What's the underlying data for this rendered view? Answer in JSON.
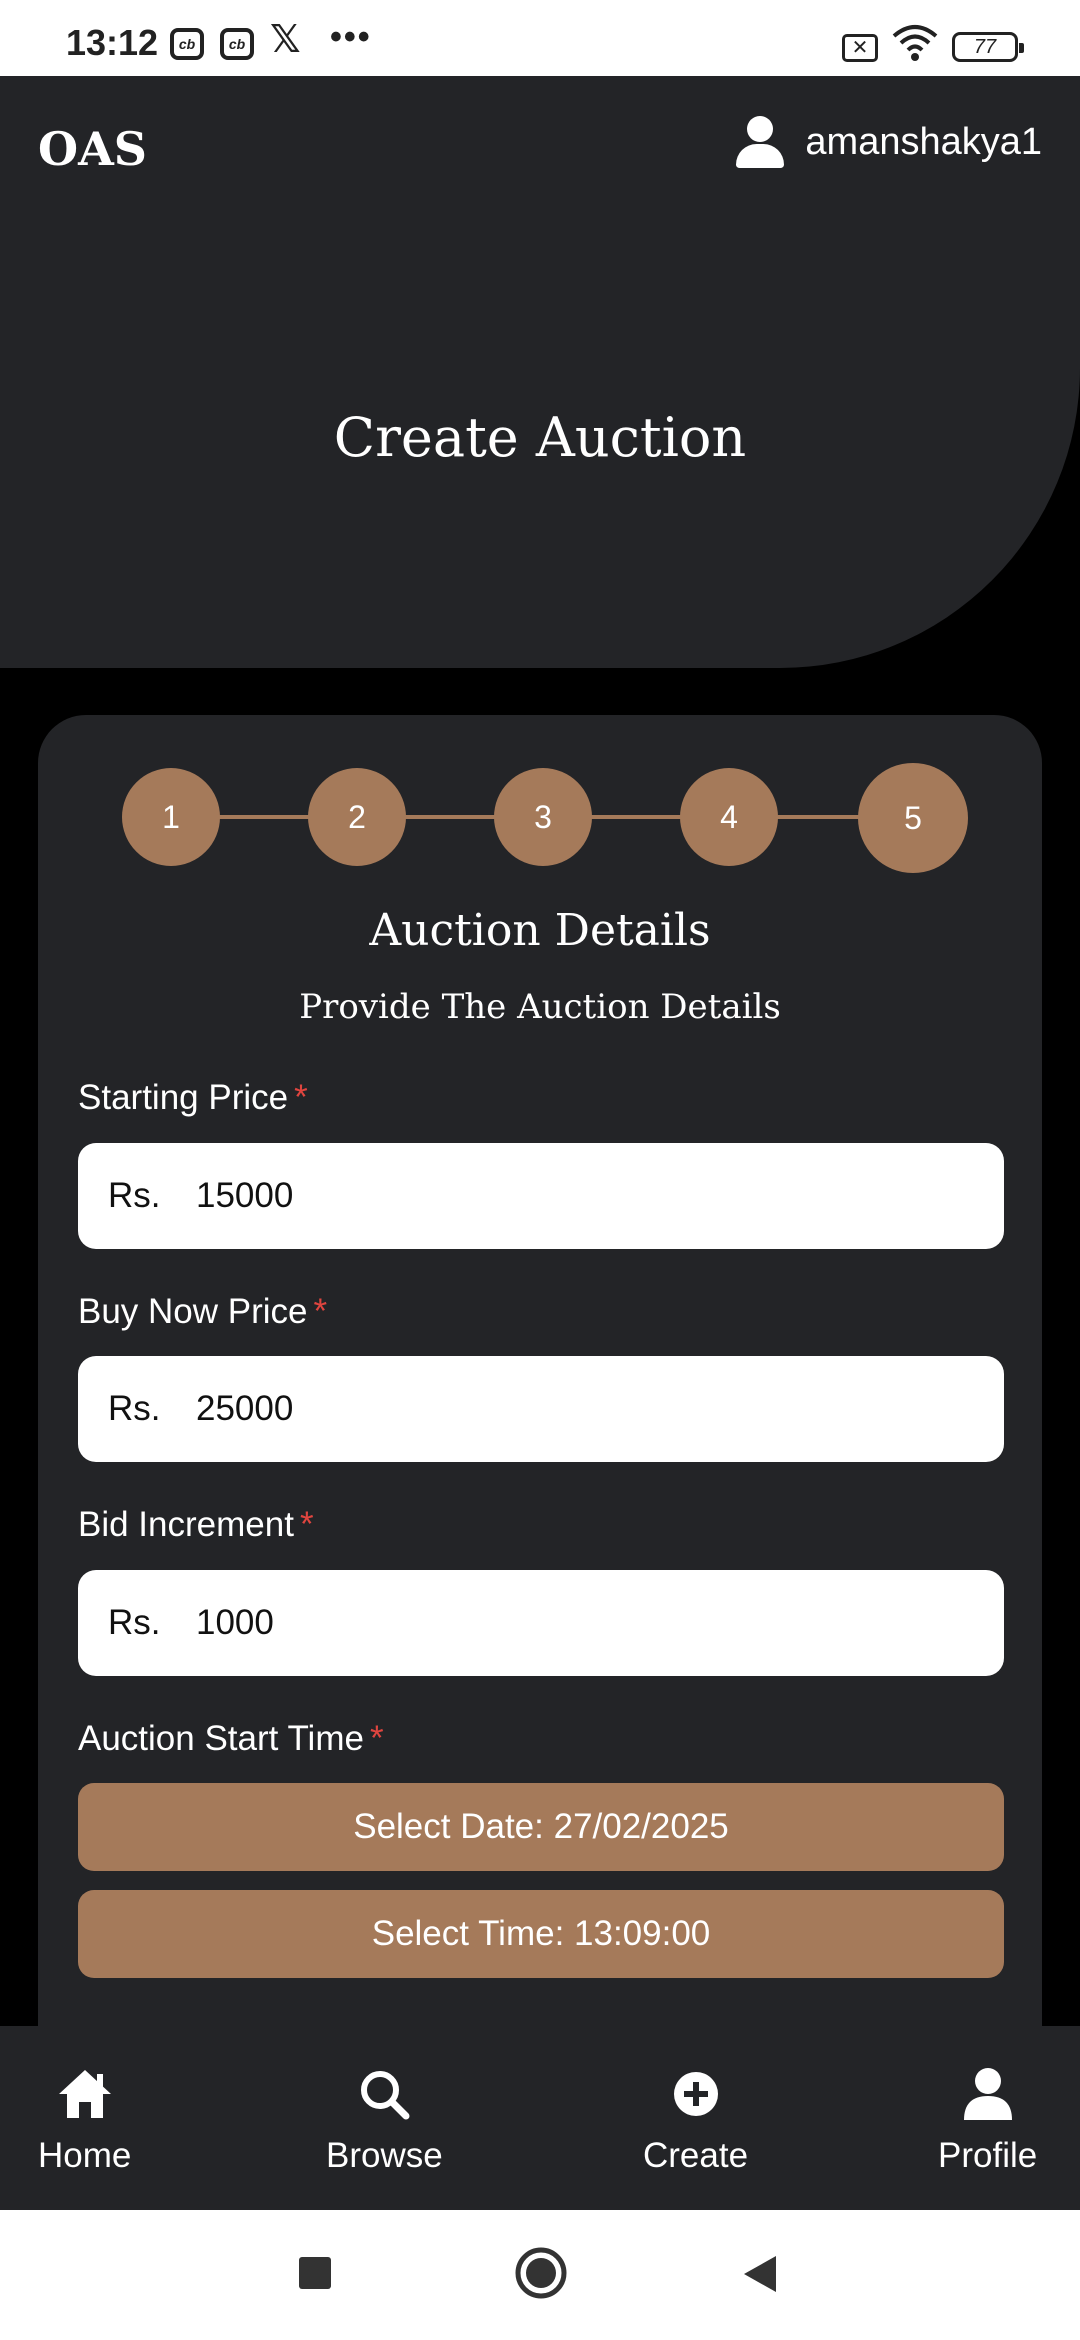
{
  "status_bar": {
    "time": "13:12",
    "icons": [
      "cb-icon",
      "cb-icon",
      "x-icon",
      "more-dots-icon",
      "no-sim-icon",
      "wifi-icon"
    ],
    "cb_text": "cb",
    "x_text": "𝕏",
    "dots_text": "•••",
    "sim_text": "✕",
    "battery": "77"
  },
  "header": {
    "logo": "OAS",
    "username": "amanshakya1",
    "title": "Create Auction"
  },
  "stepper": {
    "steps": [
      "1",
      "2",
      "3",
      "4",
      "5"
    ],
    "active_step": "5"
  },
  "section": {
    "title": "Auction Details",
    "subtitle": "Provide The Auction Details"
  },
  "form": {
    "starting_price": {
      "label": "Starting Price",
      "required": "*",
      "prefix": "Rs.",
      "value": "15000"
    },
    "buy_now_price": {
      "label": "Buy Now Price",
      "required": "*",
      "prefix": "Rs.",
      "value": "25000"
    },
    "bid_increment": {
      "label": "Bid Increment",
      "required": "*",
      "prefix": "Rs.",
      "value": "1000"
    },
    "start_time": {
      "label": "Auction Start Time",
      "required": "*",
      "date_button": "Select Date: 27/02/2025",
      "time_button": "Select Time: 13:09:00"
    }
  },
  "bottom_nav": {
    "items": [
      {
        "label": "Home",
        "icon": "home-icon"
      },
      {
        "label": "Browse",
        "icon": "search-icon"
      },
      {
        "label": "Create",
        "icon": "plus-circle-icon"
      },
      {
        "label": "Profile",
        "icon": "person-icon"
      }
    ]
  },
  "system_nav": {
    "icons": [
      "recents-square-icon",
      "home-circle-icon",
      "back-triangle-icon"
    ]
  },
  "colors": {
    "background": "#000000",
    "surface": "#232427",
    "accent": "#a57a5a",
    "required": "#e0453f",
    "input_bg": "#ffffff"
  }
}
